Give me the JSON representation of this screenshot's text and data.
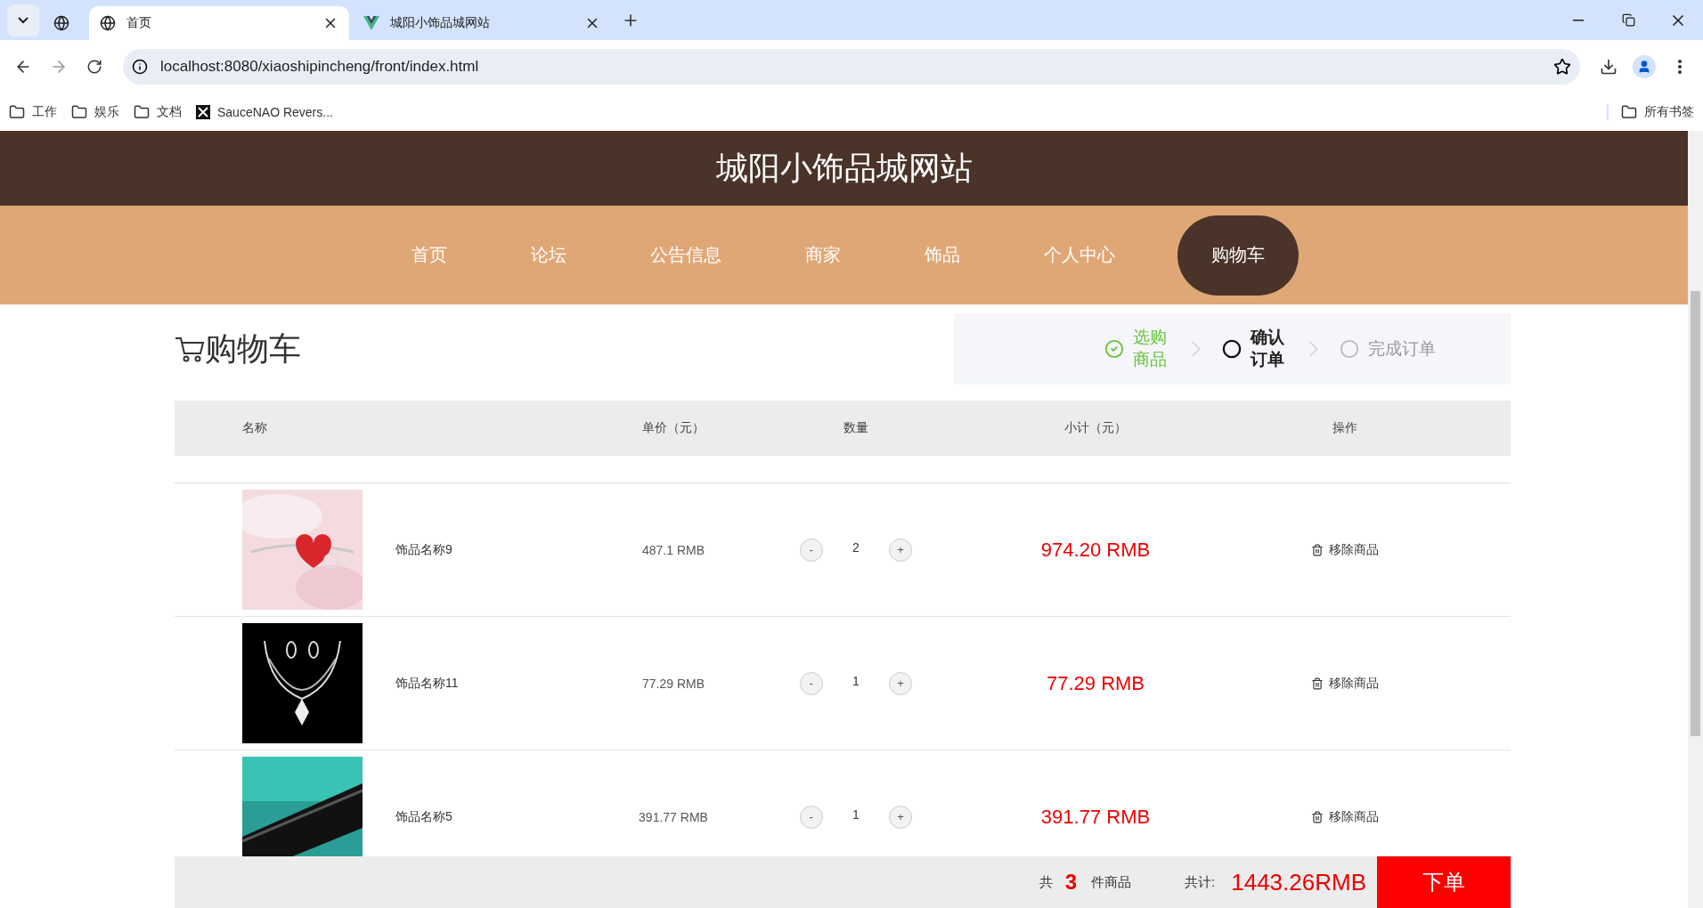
{
  "browser": {
    "tabs": [
      {
        "selected": false
      },
      {
        "title": "首页",
        "selected": true
      },
      {
        "title": "城阳小饰品城网站",
        "selected": false
      }
    ],
    "address": "localhost:8080/xiaoshipincheng/front/index.html",
    "bookmarks": [
      {
        "label": "工作",
        "kind": "folder"
      },
      {
        "label": "娱乐",
        "kind": "folder"
      },
      {
        "label": "文档",
        "kind": "folder"
      },
      {
        "label": "SauceNAO Revers...",
        "kind": "link"
      }
    ],
    "all_bookmarks": "所有书签"
  },
  "site": {
    "title": "城阳小饰品城网站",
    "nav": [
      {
        "label": "首页",
        "selected": false
      },
      {
        "label": "论坛",
        "selected": false
      },
      {
        "label": "公告信息",
        "selected": false
      },
      {
        "label": "商家",
        "selected": false
      },
      {
        "label": "饰品",
        "selected": false
      },
      {
        "label": "个人中心",
        "selected": false
      },
      {
        "label": "购物车",
        "selected": true
      }
    ]
  },
  "cart": {
    "title": "购物车",
    "steps": [
      {
        "label": "选购商品",
        "kind": "done"
      },
      {
        "label": "确认订单",
        "kind": "current"
      },
      {
        "label": "完成订单",
        "kind": "todo"
      }
    ],
    "columns": [
      "名称",
      "单价（元）",
      "数量",
      "小计（元）",
      "操作"
    ],
    "rows": [
      {
        "name": "饰品名称9",
        "price": "487.1 RMB",
        "decrement": "-",
        "quantity": "2",
        "increment": "+",
        "subtotal": "974.20 RMB",
        "action": "移除商品"
      },
      {
        "name": "饰品名称11",
        "price": "77.29 RMB",
        "decrement": "-",
        "quantity": "1",
        "increment": "+",
        "subtotal": "77.29 RMB",
        "action": "移除商品"
      },
      {
        "name": "饰品名称5",
        "price": "391.77 RMB",
        "decrement": "-",
        "quantity": "1",
        "increment": "+",
        "subtotal": "391.77 RMB",
        "action": "移除商品"
      }
    ],
    "footer": {
      "count_prefix": "共",
      "count": "3",
      "count_suffix": "件商品",
      "total_label": "共计:",
      "total": "1443.26RMB",
      "button": "下单"
    }
  }
}
